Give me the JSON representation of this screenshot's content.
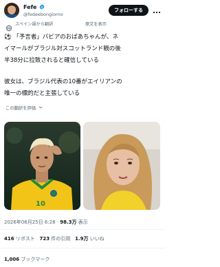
{
  "author": {
    "name": "Fefe",
    "handle": "@fedeebongiorno",
    "follow_label": "フォローする"
  },
  "translation": {
    "translated_from": "スペイン語から翻訳",
    "show_original": "原文を表示",
    "rate": "この翻訳を評価"
  },
  "tweet": {
    "line1": "⚽ 「予言者」バビアのおばあちゃんが、ネ",
    "line2": "イマールがブラジル対スコットランド戦の後",
    "line3": "半38分に拉致されると確信している",
    "line4": "彼女は、ブラジル代表の10番がエイリアンの",
    "line5": "唯一の標的だと主張している"
  },
  "media": {
    "left_jersey_number": "10"
  },
  "meta": {
    "datetime": "2026年06月25日 6:28",
    "separator": "·",
    "views_count": "98.3万",
    "views_label": "表示"
  },
  "stats": {
    "reposts_count": "416",
    "reposts_label": "リポスト",
    "quotes_count": "723",
    "quotes_label": "件の引用",
    "likes_count": "1.9万",
    "likes_label": "いいね",
    "bookmarks_count": "1,006",
    "bookmarks_label": "ブックマーク"
  },
  "colors": {
    "accent": "#1d9bf0",
    "text_primary": "#0f1419",
    "text_secondary": "#536471",
    "verified": "#1d9bf0",
    "jersey_yellow": "#f2c418",
    "jersey_green": "#1f8a3a"
  },
  "icons": {
    "verified": "verified-badge-icon",
    "more": "more-icon",
    "globe": "globe-icon"
  }
}
